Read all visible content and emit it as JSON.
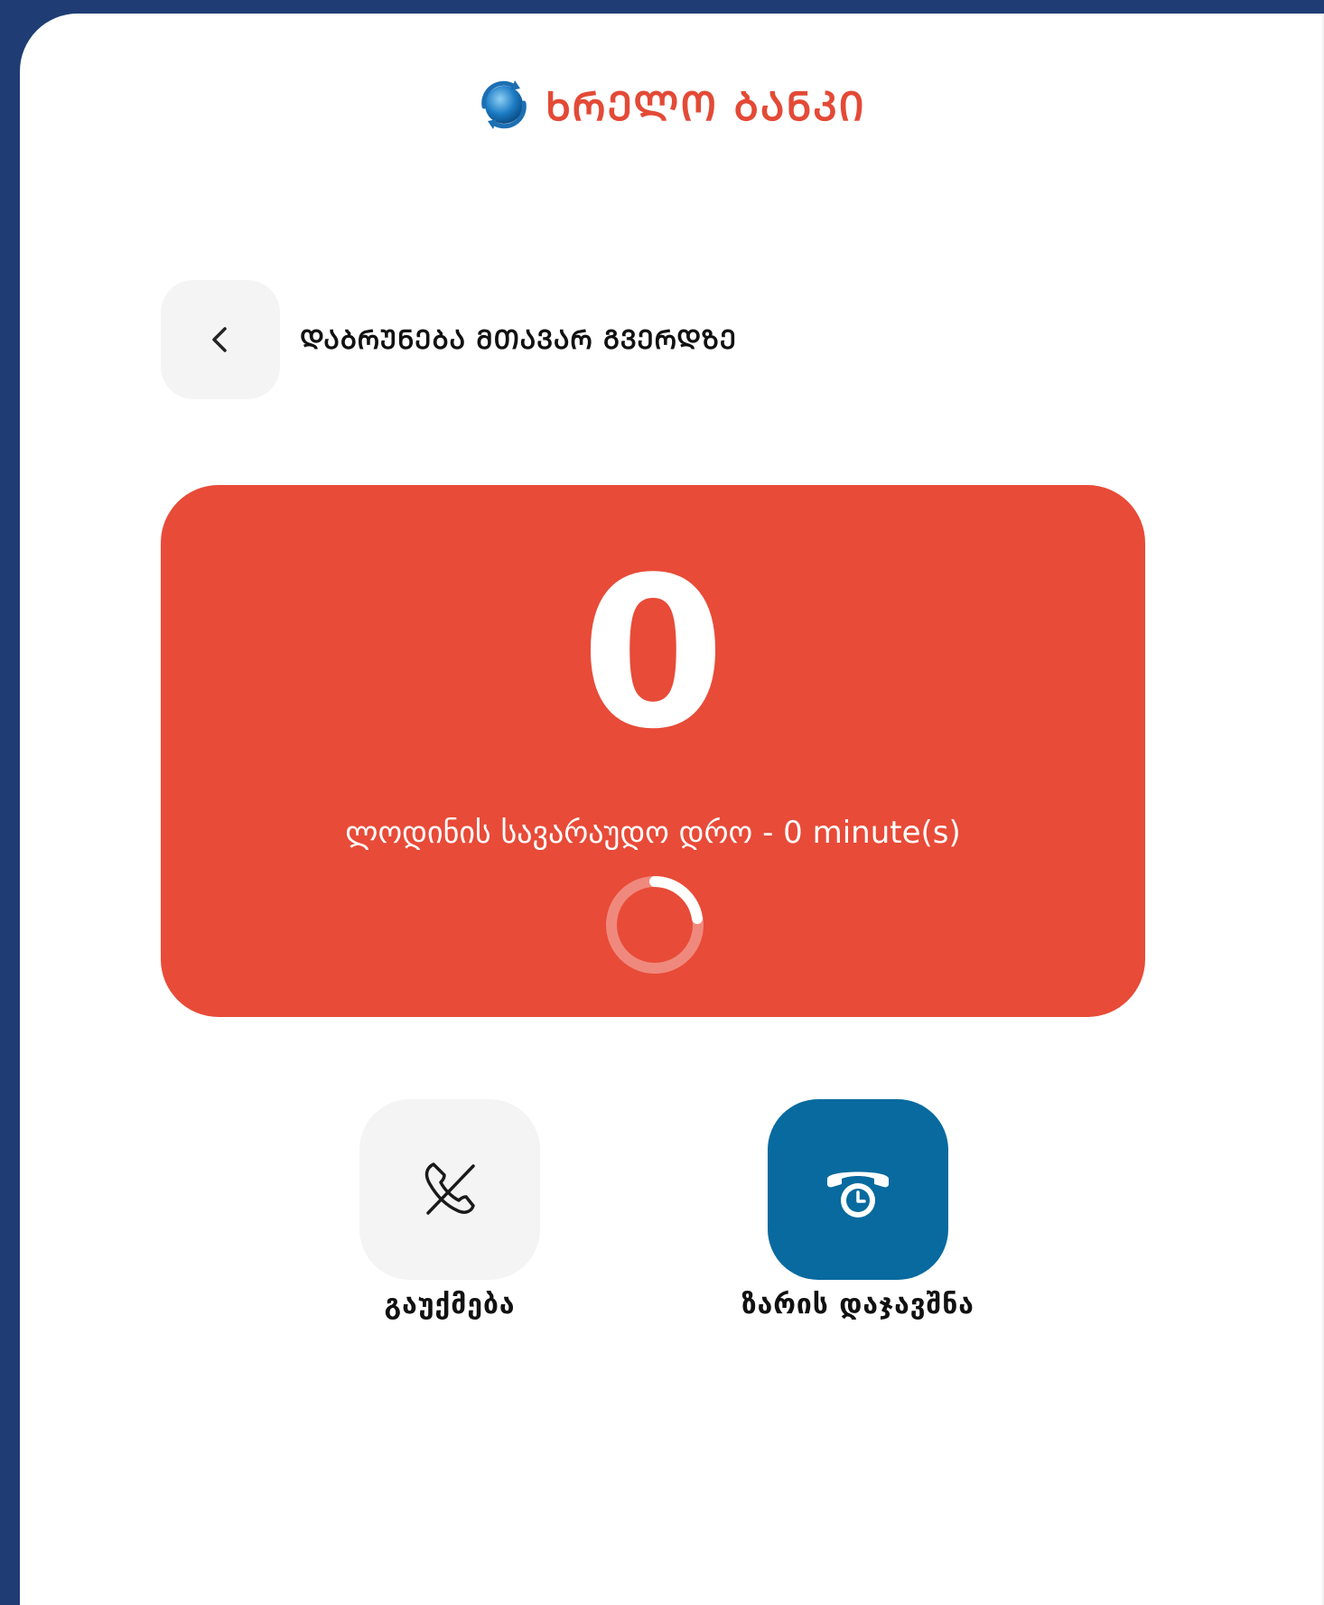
{
  "brand": {
    "name": "ᲮᲠᲔᲚᲝ ᲑᲐᲜᲙᲘ",
    "name_color": "#e34a36",
    "logo_icon": "globe-refresh-icon"
  },
  "navigation": {
    "back_icon": "chevron-left-icon",
    "back_label": "ᲓᲐᲑᲠᲣᲜᲔᲑᲐ ᲛᲗᲐᲕᲐᲠ ᲒᲕᲔᲠᲓᲖᲔ"
  },
  "queue": {
    "position": "0",
    "wait_text": "ლოდინის სავარაუდო დრო - 0 minute(s)",
    "panel_color": "#e84b38",
    "loading_icon": "loading-spinner-icon"
  },
  "actions": {
    "cancel": {
      "label": "გაუქმება",
      "icon": "phone-off-icon"
    },
    "callback": {
      "label": "ზარის დაჯავშნა",
      "icon": "phone-clock-icon",
      "color": "#086a9e"
    }
  }
}
